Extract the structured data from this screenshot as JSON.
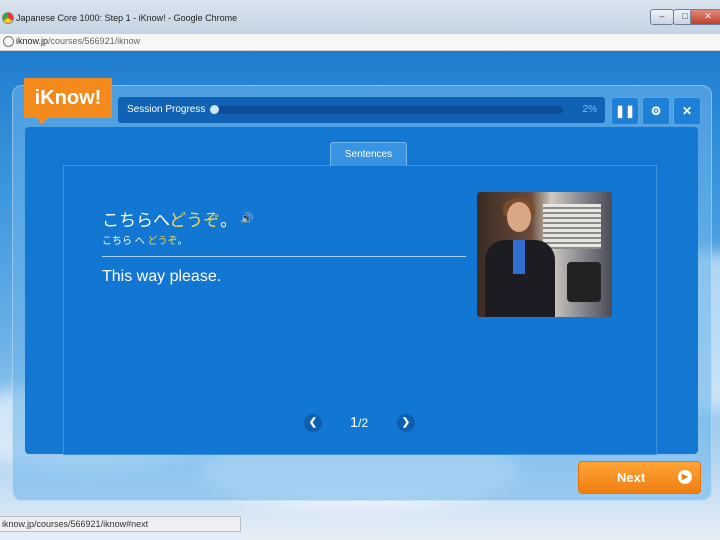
{
  "window": {
    "title": "Japanese Core 1000: Step 1 - iKnow! - Google Chrome",
    "controls": [
      "minimize",
      "maximize",
      "close"
    ]
  },
  "address_bar": {
    "domain": "iknow.jp",
    "path": "/courses/566921/iknow"
  },
  "app": {
    "logo": "iKnow!",
    "session": {
      "label": "Session Progress",
      "percent_text": "2%",
      "progress": 0.02
    },
    "controls": {
      "pause_icon": "pause-icon",
      "settings_icon": "gear-icon",
      "close_icon": "close-icon"
    },
    "tab": "Sentences",
    "sentence": {
      "japanese_prefix": "こちらへ",
      "japanese_highlight": "どうぞ",
      "japanese_suffix": "。",
      "kana_prefix": "こちら へ ",
      "kana_highlight": "どうぞ",
      "kana_suffix": "。",
      "english": "This way please.",
      "audio_icon": "speaker-icon"
    },
    "pager": {
      "current": "1",
      "separator": "/",
      "total": "2",
      "prev_icon": "chevron-left-icon",
      "next_icon": "chevron-right-icon"
    },
    "next_button": "Next",
    "highlight_color": "#f3d84a",
    "accent_color": "#f58a1c"
  },
  "status_bar": "iknow.jp/courses/566921/iknow#next"
}
